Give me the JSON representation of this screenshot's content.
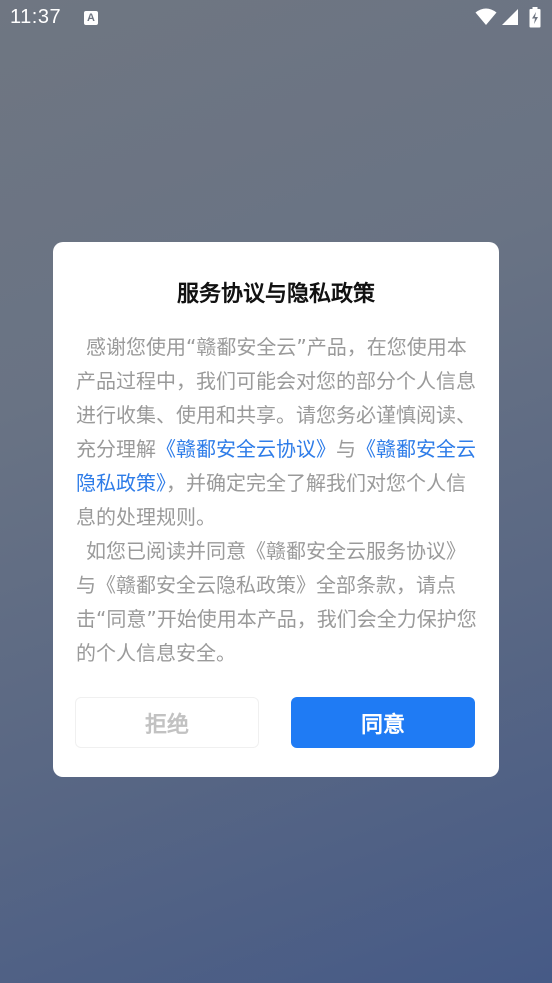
{
  "status_bar": {
    "time": "11:37",
    "notification_icon_letter": "A",
    "icons": [
      "notification-a-icon",
      "wifi-icon",
      "signal-icon",
      "battery-icon"
    ]
  },
  "dialog": {
    "title": "服务协议与隐私政策",
    "paragraph1": {
      "text_before": "感谢您使用“赣鄱安全云”产品，在您使用本产品过程中，我们可能会对您的部分个人信息进行收集、使用和共享。请您务必谨慎阅读、充分理解",
      "link_service": "《赣鄱安全云协议》",
      "text_and": "与",
      "link_privacy": "《赣鄱安全云隐私政策》",
      "text_after": "，并确定完全了解我们对您个人信息的处理规则。"
    },
    "paragraph2": "如您已阅读并同意《赣鄱安全云服务协议》与《赣鄱安全云隐私政策》全部条款，请点击“同意”开始使用本产品，我们会全力保护您的个人信息安全。",
    "decline_label": "拒绝",
    "agree_label": "同意"
  },
  "colors": {
    "link": "#2e7ce8",
    "primary_button": "#1f7bf4",
    "body_text": "#9a9a9a"
  }
}
